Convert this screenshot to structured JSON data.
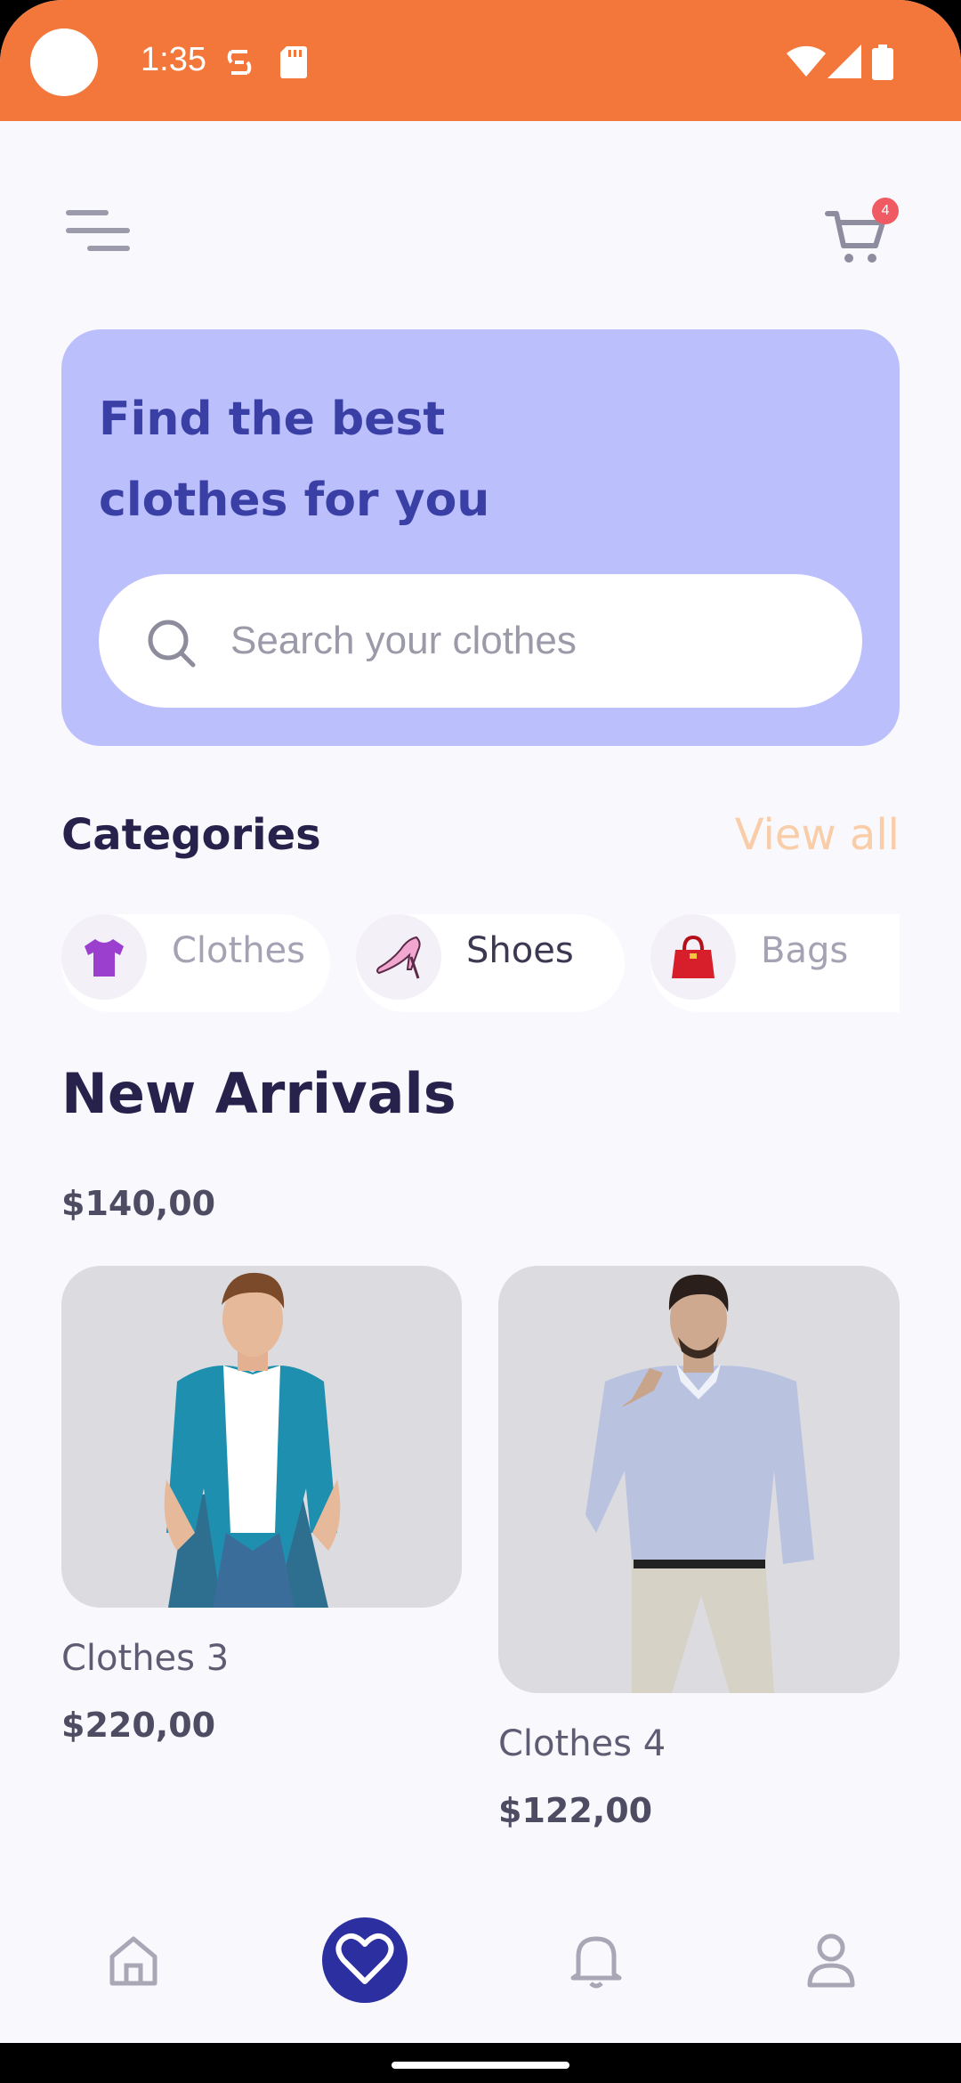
{
  "status_bar": {
    "time": "1:35"
  },
  "cart": {
    "badge_count": "4"
  },
  "hero": {
    "title_line1": "Find the best",
    "title_line2": "clothes for you",
    "search_placeholder": "Search your clothes"
  },
  "categories": {
    "title": "Categories",
    "view_all": "View all",
    "items": [
      {
        "label": "Clothes",
        "icon": "tshirt-icon",
        "selected": false
      },
      {
        "label": "Shoes",
        "icon": "high-heel-icon",
        "selected": true
      },
      {
        "label": "Bags",
        "icon": "handbag-icon",
        "selected": false
      }
    ]
  },
  "new_arrivals": {
    "title": "New Arrivals",
    "partial_price": "$140,00",
    "products": [
      {
        "name": "Clothes 3",
        "price": "$220,00"
      },
      {
        "name": "Clothes 4",
        "price": "$122,00"
      }
    ]
  },
  "bottom_nav": {
    "items": [
      "home-icon",
      "heart-icon",
      "bell-icon",
      "user-icon"
    ],
    "active": "heart-icon"
  },
  "colors": {
    "status_bar": "#f3773b",
    "hero_bg": "#bbbffc",
    "hero_title": "#3a3fa6",
    "accent": "#2c2fa0",
    "view_all": "#f9cda8",
    "badge": "#ef5a63"
  }
}
